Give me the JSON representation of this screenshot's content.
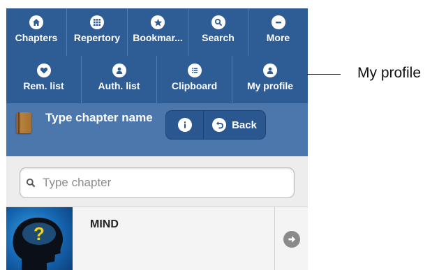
{
  "toolbar": {
    "row1": [
      {
        "label": "Chapters",
        "icon": "home-icon"
      },
      {
        "label": "Repertory",
        "icon": "grid-icon"
      },
      {
        "label": "Bookmar...",
        "icon": "star-icon"
      },
      {
        "label": "Search",
        "icon": "search-icon"
      },
      {
        "label": "More",
        "icon": "minus-icon"
      }
    ],
    "row2": [
      {
        "label": "Rem. list",
        "icon": "heart-icon"
      },
      {
        "label": "Auth. list",
        "icon": "user-icon"
      },
      {
        "label": "Clipboard",
        "icon": "list-icon"
      },
      {
        "label": "My profile",
        "icon": "user-icon"
      }
    ]
  },
  "chapter_bar": {
    "title": "Type chapter name",
    "info_icon": "info-icon",
    "back_label": "Back",
    "back_icon": "undo-icon"
  },
  "search": {
    "placeholder": "Type chapter",
    "icon": "search-icon"
  },
  "list": [
    {
      "title": "MIND",
      "thumbnail": "head-question-icon",
      "arrow": "arrow-right-icon"
    }
  ],
  "callout": {
    "label": "My profile"
  },
  "colors": {
    "toolbar_bg": "#2e5d96",
    "chapter_bar_bg": "#4c77ad",
    "list_bg": "#ededed"
  }
}
